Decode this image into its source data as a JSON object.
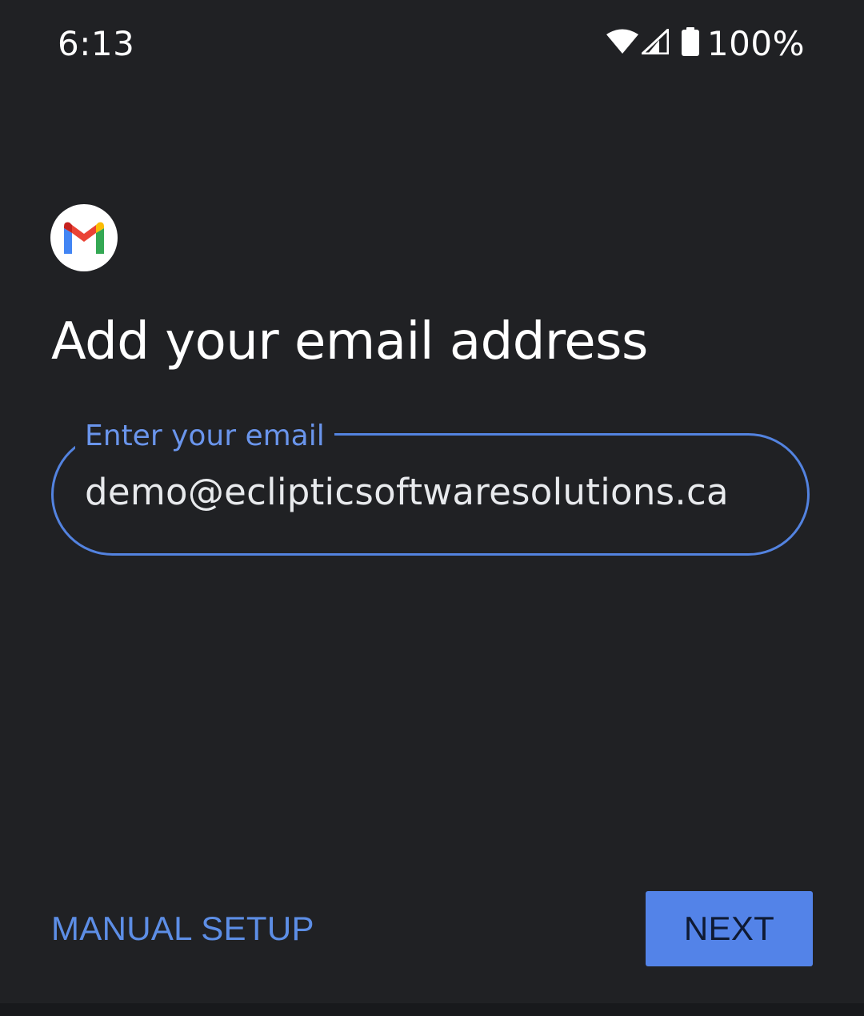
{
  "status_bar": {
    "time": "6:13",
    "battery_percent": "100%",
    "icons": [
      "wifi-icon",
      "cell-signal-icon",
      "battery-icon"
    ]
  },
  "app": {
    "logo_icon": "gmail-logo-icon"
  },
  "page": {
    "title": "Add your email address"
  },
  "email_field": {
    "label": "Enter your email",
    "value": "demo@eclipticsoftwaresolutions.ca"
  },
  "actions": {
    "manual_setup_label": "MANUAL SETUP",
    "next_label": "NEXT"
  },
  "colors": {
    "background": "#202124",
    "accent": "#5383e8",
    "gmail_red": "#ea4335",
    "gmail_blue": "#4285f4",
    "gmail_green": "#34a853",
    "gmail_yellow": "#fbbc04"
  }
}
